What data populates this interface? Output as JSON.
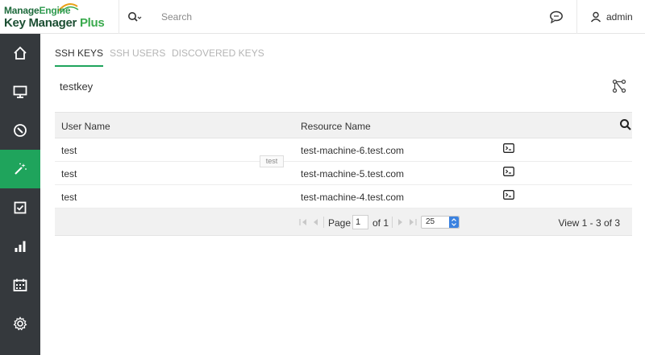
{
  "brand": {
    "line1_a": "Manage",
    "line1_b": "Engine",
    "line2_a": "Key Manager ",
    "line2_b": "Plus"
  },
  "header": {
    "search_placeholder": "Search",
    "user_name": "admin"
  },
  "sidebar": {
    "items": [
      {
        "icon": "home-icon"
      },
      {
        "icon": "monitor-icon"
      },
      {
        "icon": "compass-icon"
      },
      {
        "icon": "magic-wand-icon",
        "active": true
      },
      {
        "icon": "checklist-icon"
      },
      {
        "icon": "bar-chart-icon"
      },
      {
        "icon": "calendar-icon"
      },
      {
        "icon": "gear-icon"
      }
    ],
    "active_color": "#1fa45c",
    "bg_color": "#35393d"
  },
  "tabs": [
    {
      "label": "SSH KEYS",
      "active": true
    },
    {
      "label": "SSH USERS",
      "active": false
    },
    {
      "label": "DISCOVERED KEYS",
      "active": false
    }
  ],
  "key_name": "testkey",
  "table": {
    "columns": [
      "User Name",
      "Resource Name"
    ],
    "rows": [
      {
        "user": "test",
        "resource": "test-machine-6.test.com"
      },
      {
        "user": "test",
        "resource": "test-machine-5.test.com"
      },
      {
        "user": "test",
        "resource": "test-machine-4.test.com"
      }
    ],
    "tooltip": "test"
  },
  "pager": {
    "page_label": "Page",
    "page_value": "1",
    "of_label": "of 1",
    "page_size": "25",
    "view_text": "View 1 - 3 of 3"
  }
}
